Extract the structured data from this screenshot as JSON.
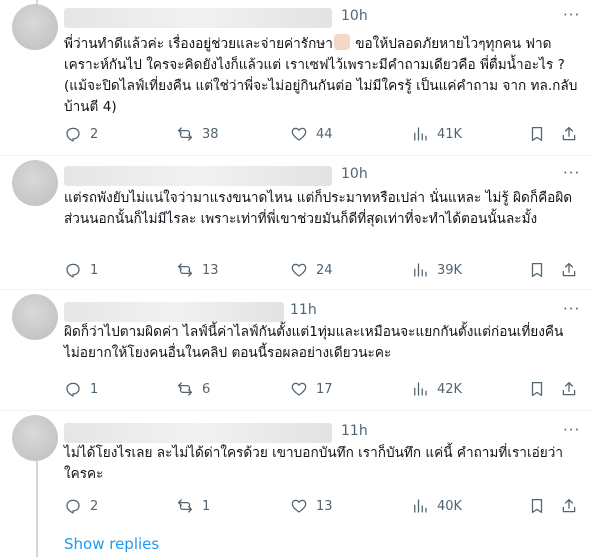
{
  "replies": [
    {
      "time": "10h",
      "text": "พี่ว่านทำดีแล้วค่ะ เรื่องอยู่ช่วยและจ่ายค่ารักษา",
      "text_after_emoji": " ขอให้ปลอดภัยหายไวๆทุกคน ฟาดเคราะห์กันไป ใครจะคิดยังไงก็แล้วแต่ เราเซฟไว้เพราะมีคำถามเดียวคือ พี่ตื่มน้ำอะไร ? (แม้จะปิดไลฟ์เที่ยงคืน แต่ใช่ว่าพี่จะไม่อยู่กินกันต่อ ไม่มีใครรู้ เป็นแค่คำถาม จาก ทล.กลับบ้านตี 4)",
      "replies": "2",
      "reposts": "38",
      "likes": "44",
      "views": "41K"
    },
    {
      "time": "10h",
      "text": "แต่รถพังยับไม่แน่ใจว่ามาแรงขนาดไหน แต่ก็ประมาทหรือเปล่า นั่นแหละ ไม่รู้ ผิดก็คือผิด ส่วนนอกนั้นก็ไม่มีไรละ เพราะเท่าที่พี่เขาช่วยมันก็ดีที่สุดเท่าที่จะทำได้ตอนนั้นละมั้ง",
      "replies": "1",
      "reposts": "13",
      "likes": "24",
      "views": "39K"
    },
    {
      "time": "11h",
      "text": "ผิดก็ว่าไปตามผิดค่า ไลฟ์นี้ค่าไลฟ์กันตั้งแต่1ทุ่มและเหมือนจะแยกกันตั้งแต่ก่อนเที่ยงคืน ไม่อยากให้โยงคนอื่นในคลิป ตอนนี้รอผลอย่างเดียวนะคะ",
      "replies": "1",
      "reposts": "6",
      "likes": "17",
      "views": "42K"
    },
    {
      "time": "11h",
      "text": "ไม่ได้โยงไรเลย ละไม่ได้ด่าใครด้วย เขาบอกบันทึก เราก็บันทึก แค่นี้ คำถามที่เราเอ่ยว่าใครคะ",
      "replies": "2",
      "reposts": "1",
      "likes": "13",
      "views": "40K"
    }
  ],
  "more_label": "···",
  "show_replies_label": "Show replies",
  "icons": [
    "reply-icon",
    "repost-icon",
    "like-icon",
    "views-icon",
    "bookmark-icon",
    "share-icon"
  ],
  "colors": {
    "text": "#0f1419",
    "muted": "#536471",
    "link": "#1d9bf0",
    "divider": "#eff3f4"
  }
}
